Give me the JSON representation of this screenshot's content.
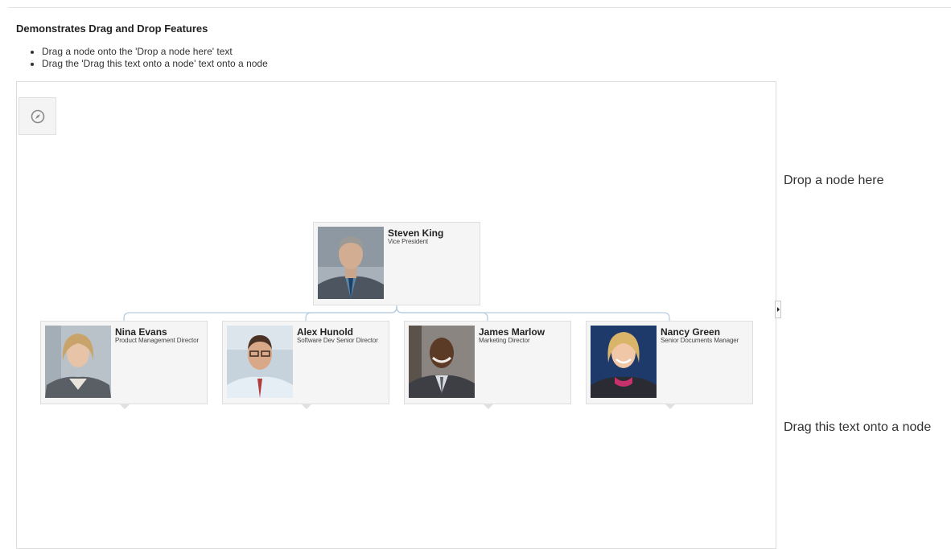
{
  "page": {
    "title": "Demonstrates Drag and Drop Features",
    "instructions": [
      "Drag a node onto the 'Drop a node here' text",
      "Drag the 'Drag this text onto a node' text onto a node"
    ]
  },
  "diagram": {
    "overview_button_icon": "compass-icon",
    "root": {
      "name": "Steven King",
      "title": "Vice President"
    },
    "children": [
      {
        "name": "Nina Evans",
        "title": "Product Management Director"
      },
      {
        "name": "Alex Hunold",
        "title": "Software Dev Senior Director"
      },
      {
        "name": "James Marlow",
        "title": "Marketing Director"
      },
      {
        "name": "Nancy Green",
        "title": "Senior Documents Manager"
      }
    ],
    "connector_color": "#b7cde0"
  },
  "splitter_icon": "caret-right-icon",
  "drop_target_text": "Drop a node here",
  "drag_source_text": "Drag this text onto a node"
}
